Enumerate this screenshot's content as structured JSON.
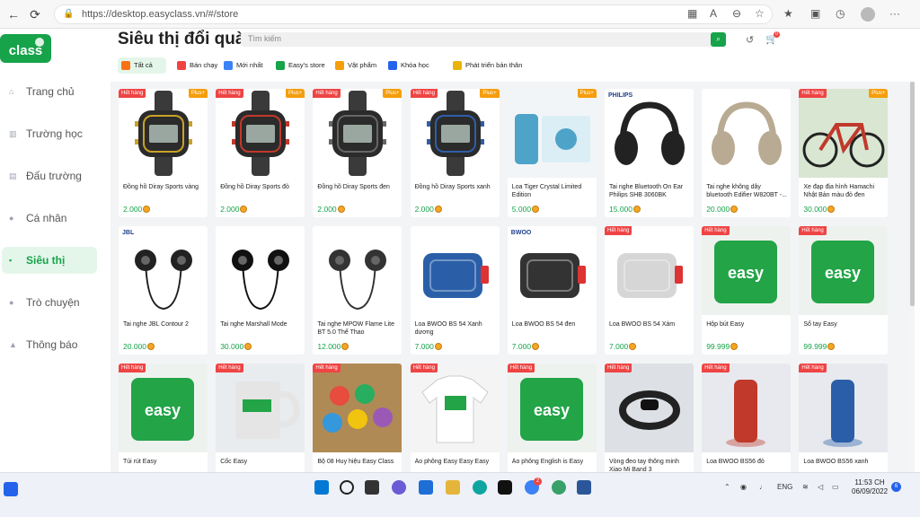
{
  "browser": {
    "url": "https://desktop.easyclass.vn/#/store",
    "back": "←",
    "reload": "⟳",
    "home": "⌂",
    "lock": "🔒",
    "menu": "···"
  },
  "logo": {
    "text": "class",
    "color": "#16a34a"
  },
  "sidebar": {
    "items": [
      {
        "label": "Trang chủ",
        "icon": "home-icon",
        "glyph": "⌂"
      },
      {
        "label": "Trường học",
        "icon": "school-icon",
        "glyph": "▥"
      },
      {
        "label": "Đấu trường",
        "icon": "arena-icon",
        "glyph": "▤"
      },
      {
        "label": "Cá nhân",
        "icon": "user-icon",
        "glyph": "●"
      },
      {
        "label": "Siêu thị",
        "icon": "cart-icon",
        "glyph": "▪",
        "active": true
      },
      {
        "label": "Trò chuyện",
        "icon": "chat-icon",
        "glyph": "●"
      },
      {
        "label": "Thông báo",
        "icon": "bell-icon",
        "glyph": "▲"
      }
    ]
  },
  "page": {
    "title": "Siêu thị đổi quà",
    "search_placeholder": "Tìm kiếm",
    "cart_count": "0"
  },
  "categories": [
    {
      "label": "Tất cả",
      "color": "#f97316",
      "active": true
    },
    {
      "label": "Bán chạy",
      "color": "#ef4444"
    },
    {
      "label": "Mới nhất",
      "color": "#3b82f6"
    },
    {
      "label": "Easy's store",
      "color": "#16a34a"
    },
    {
      "label": "Vật phẩm",
      "color": "#f59e0b"
    },
    {
      "label": "Khóa học",
      "color": "#2563eb"
    },
    {
      "label": "Phát triển bản thân",
      "color": "#eab308"
    }
  ],
  "products": [
    {
      "name": "Đồng hồ Diray Sports vàng",
      "price": "2.000",
      "hot": "Hết hàng",
      "plus": "Plus+",
      "kind": "watch",
      "accent": "#c9a227"
    },
    {
      "name": "Đồng hồ Diray Sports đỏ",
      "price": "2.000",
      "hot": "Hết hàng",
      "plus": "Plus+",
      "kind": "watch",
      "accent": "#c0392b"
    },
    {
      "name": "Đồng hồ Diray Sports đen",
      "price": "2.000",
      "hot": "Hết hàng",
      "plus": "Plus+",
      "kind": "watch",
      "accent": "#666666"
    },
    {
      "name": "Đồng hồ Diray Sports xanh",
      "price": "2.000",
      "hot": "Hết hàng",
      "plus": "Plus+",
      "kind": "watch",
      "accent": "#2f5ea8"
    },
    {
      "name": "Loa Tiger Crystal Limited Edition",
      "price": "5.000",
      "hot": "",
      "plus": "Plus+",
      "kind": "box",
      "accent": "#4ea3c8"
    },
    {
      "name": "Tai nghe Bluetooth On Ear Philips SHB 3060BK",
      "price": "15.000",
      "hot": "",
      "plus": "",
      "kind": "headphone",
      "accent": "#222222",
      "brand": "PHILIPS"
    },
    {
      "name": "Tai nghe không dây bluetooth Edifier W820BT -...",
      "price": "20.000",
      "hot": "",
      "plus": "",
      "kind": "headphone",
      "accent": "#b9aa93"
    },
    {
      "name": "Xe đạp địa hình Hamachi Nhật Bản màu đỏ đen",
      "price": "30.000",
      "hot": "Hết hàng",
      "plus": "Plus+",
      "kind": "bike",
      "accent": "#c0392b"
    },
    {
      "name": "Tai nghe JBL Contour 2",
      "price": "20.000",
      "hot": "",
      "plus": "",
      "kind": "earbud",
      "accent": "#222222",
      "brand": "JBL"
    },
    {
      "name": "Tai nghe Marshall Mode",
      "price": "30.000",
      "hot": "",
      "plus": "",
      "kind": "earbud",
      "accent": "#111111"
    },
    {
      "name": "Tai nghe MPOW Flame Lite BT 5.0 Thể Thao",
      "price": "12.000",
      "hot": "",
      "plus": "",
      "kind": "earbud",
      "accent": "#333333"
    },
    {
      "name": "Loa BWOO BS 54 Xanh dương",
      "price": "7.000",
      "hot": "",
      "plus": "",
      "kind": "speaker",
      "accent": "#2a5fa8"
    },
    {
      "name": "Loa BWOO BS 54 đen",
      "price": "7.000",
      "hot": "",
      "plus": "",
      "kind": "speaker",
      "accent": "#333333",
      "brand": "BWOO"
    },
    {
      "name": "Loa BWOO BS 54 Xám",
      "price": "7.000",
      "hot": "Hết hàng",
      "plus": "",
      "kind": "speaker",
      "accent": "#d6d6d6",
      "brand": "BWOO"
    },
    {
      "name": "Hộp bút Easy",
      "price": "99.999",
      "hot": "Hết hàng",
      "plus": "",
      "kind": "green",
      "accent": "#22a447"
    },
    {
      "name": "Sổ tay Easy",
      "price": "99.999",
      "hot": "Hết hàng",
      "plus": "",
      "kind": "green",
      "accent": "#22a447"
    },
    {
      "name": "Túi rút Easy",
      "price": "",
      "hot": "Hết hàng",
      "plus": "",
      "kind": "green",
      "accent": "#22a447"
    },
    {
      "name": "Cốc Easy",
      "price": "",
      "hot": "Hết hàng",
      "plus": "",
      "kind": "mug",
      "accent": "#e5e5e5"
    },
    {
      "name": "Bộ 08 Huy hiệu Easy Class",
      "price": "",
      "hot": "Hết hàng",
      "plus": "",
      "kind": "badges",
      "accent": "#b08a55"
    },
    {
      "name": "Áo phông Easy Easy Easy",
      "price": "",
      "hot": "Hết hàng",
      "plus": "",
      "kind": "shirt",
      "accent": "#ffffff"
    },
    {
      "name": "Áo phông English is Easy",
      "price": "",
      "hot": "Hết hàng",
      "plus": "",
      "kind": "green",
      "accent": "#22a447"
    },
    {
      "name": "Vòng đeo tay thông minh Xiao Mi Band 3",
      "price": "",
      "hot": "Hết hàng",
      "plus": "",
      "kind": "band",
      "accent": "#222222"
    },
    {
      "name": "Loa BWOO BS56 đỏ",
      "price": "",
      "hot": "Hết hàng",
      "plus": "",
      "kind": "tower",
      "accent": "#c0392b"
    },
    {
      "name": "Loa BWOO BS56 xanh",
      "price": "",
      "hot": "Hết hàng",
      "plus": "",
      "kind": "tower",
      "accent": "#2a5fa8"
    }
  ],
  "taskbar": {
    "lang": "ENG",
    "time": "11:53 CH",
    "date": "06/09/2022",
    "notif": "6",
    "mail_badge": "2"
  }
}
